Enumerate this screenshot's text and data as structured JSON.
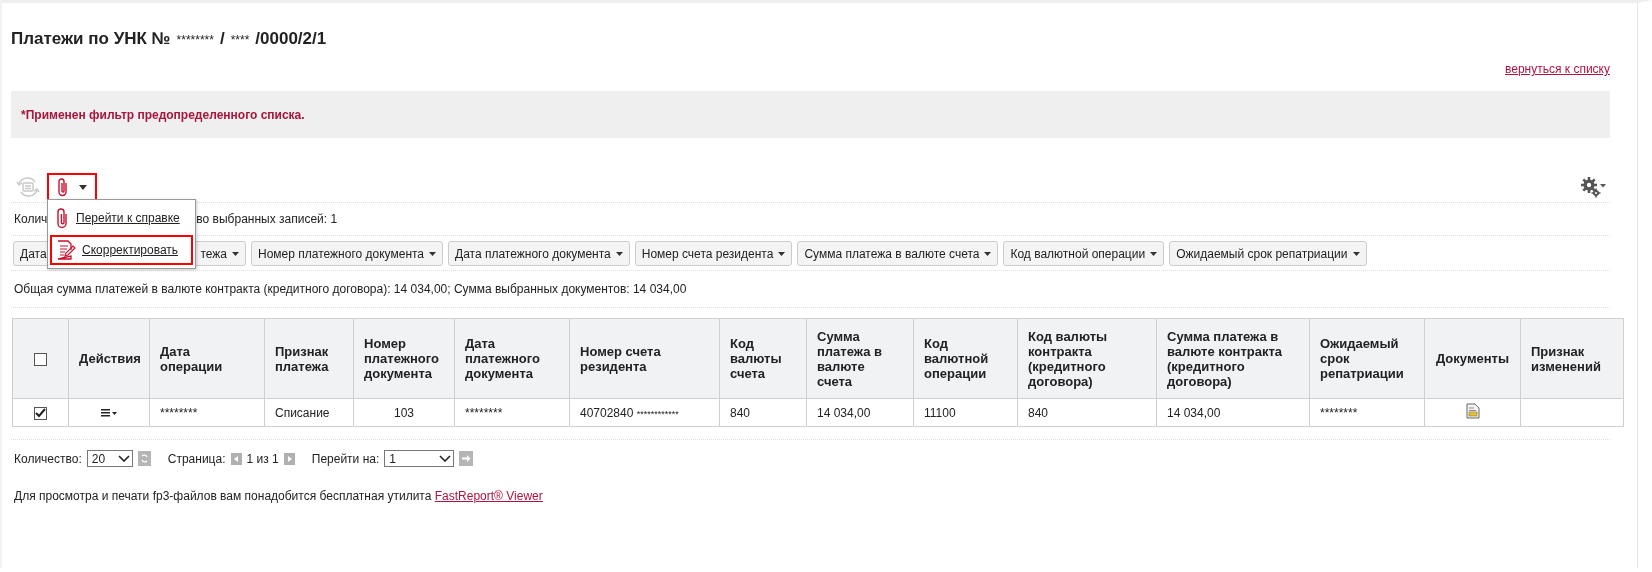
{
  "title": [
    {
      "kind": "bold",
      "text": "Платежи по УНК №"
    },
    {
      "kind": "mask",
      "text": "********"
    },
    {
      "kind": "bold",
      "text": "/"
    },
    {
      "kind": "mask",
      "text": "****"
    },
    {
      "kind": "bold",
      "text": "/0000/2/1"
    }
  ],
  "back_link": "вернуться к списку",
  "filter_notice": "*Применен фильтр предопределенного списка.",
  "toolbar": {
    "attach_highlighted": true
  },
  "menu": {
    "items": [
      {
        "kind": "attach",
        "label": "Перейти к справке",
        "highlighted": false
      },
      {
        "kind": "edit",
        "label": "Скорректировать",
        "highlighted": true
      }
    ]
  },
  "record_count": [
    "Колич",
    "во выбранных записей: 1"
  ],
  "filter_chips": [
    {
      "label": "Дата"
    },
    {
      "label": "тежа"
    },
    {
      "label": "Номер платежного документа"
    },
    {
      "label": "Дата платежного документа"
    },
    {
      "label": "Номер счета резидента"
    },
    {
      "label": "Сумма платежа в валюте счета"
    },
    {
      "label": "Код валютной операции"
    },
    {
      "label": "Ожидаемый срок репатриации"
    }
  ],
  "total_line": "Общая сумма платежей в валюте контракта (кредитного договора): 14 034,00; Сумма выбранных документов: 14 034,00",
  "table": {
    "header_checked": false,
    "columns": [
      "Действия",
      "Дата операции",
      "Признак платежа",
      "Номер платежного документа",
      "Дата платежного документа",
      "Номер счета резидента",
      "Код валюты счета",
      "Сумма платежа в валюте счета",
      "Код валютной операции",
      "Код валюты контракта (кредитного договора)",
      "Сумма платежа в валюте контракта (кредитного договора)",
      "Ожидаемый срок репатриации",
      "Документы",
      "Признак изменений"
    ],
    "rows": [
      {
        "selected": true,
        "cells": [
          {
            "kind": "actions"
          },
          {
            "kind": "text",
            "text": "********"
          },
          {
            "kind": "text",
            "text": "Списание"
          },
          {
            "kind": "center",
            "text": "103"
          },
          {
            "kind": "text",
            "text": "********"
          },
          {
            "kind": "account",
            "text": "40702840",
            "mask": "************"
          },
          {
            "kind": "text",
            "text": "840"
          },
          {
            "kind": "text",
            "text": "14 034,00"
          },
          {
            "kind": "text",
            "text": "11100"
          },
          {
            "kind": "text",
            "text": "840"
          },
          {
            "kind": "text",
            "text": "14 034,00"
          },
          {
            "kind": "text",
            "text": "********"
          },
          {
            "kind": "document"
          },
          {
            "kind": "empty"
          }
        ]
      }
    ]
  },
  "pagination": {
    "count_label": "Количество:",
    "count_value": "20",
    "page_label": "Страница:",
    "page_info": "1 из 1",
    "goto_label": "Перейти на:",
    "goto_value": "1"
  },
  "footer": {
    "text": "Для просмотра и печати fp3-файлов вам понадобится бесплатная утилита",
    "link": "FastReport® Viewer"
  }
}
